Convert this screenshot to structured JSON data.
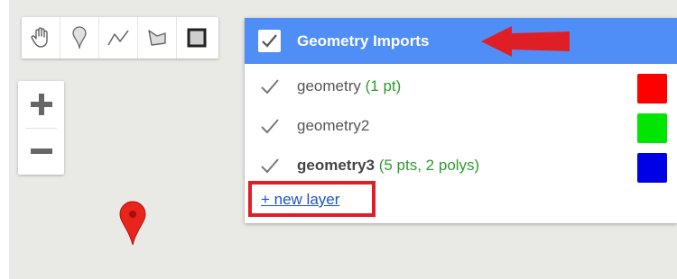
{
  "toolbar": {
    "tools": [
      {
        "name": "pan-tool",
        "icon": "hand-icon"
      },
      {
        "name": "point-tool",
        "icon": "marker-pin-icon"
      },
      {
        "name": "line-tool",
        "icon": "polyline-icon"
      },
      {
        "name": "polygon-tool",
        "icon": "polygon-icon"
      },
      {
        "name": "rectangle-tool",
        "icon": "rectangle-icon"
      }
    ]
  },
  "zoom": {
    "in_label": "+",
    "out_label": "−"
  },
  "panel": {
    "title": "Geometry Imports",
    "header_color": "#4f8ef7",
    "layers": [
      {
        "name": "geometry",
        "count": "(1 pt)",
        "color": "#ff0000",
        "bold": false
      },
      {
        "name": "geometry2",
        "count": "",
        "color": "#00e600",
        "bold": false
      },
      {
        "name": "geometry3",
        "count": "(5 pts, 2 polys)",
        "color": "#0000e6",
        "bold": true
      }
    ],
    "new_layer_label": "+ new layer"
  },
  "annotations": {
    "highlight_color": "#e01e25"
  }
}
